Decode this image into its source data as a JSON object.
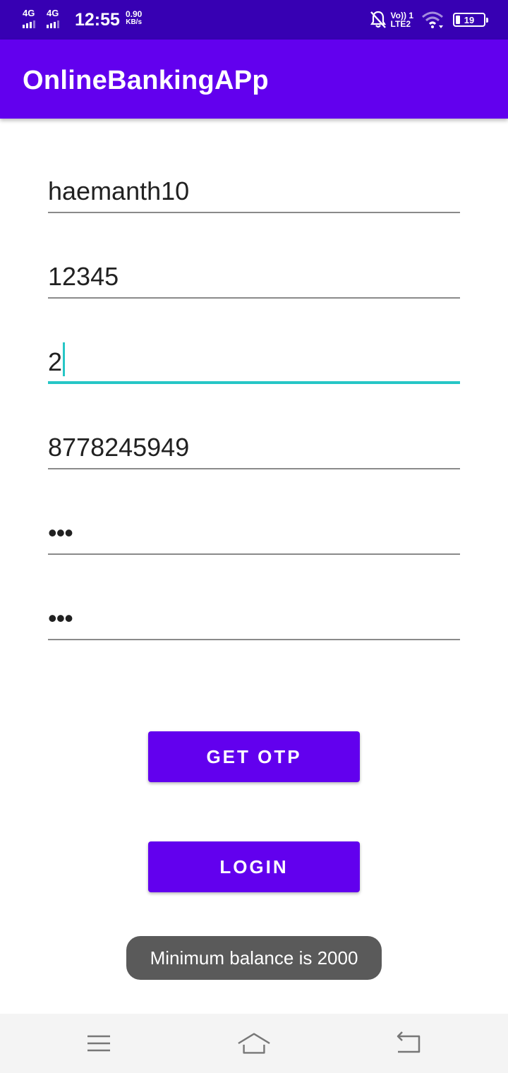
{
  "status_bar": {
    "sim1": "4G",
    "sim2": "4G",
    "time": "12:55",
    "speed_value": "0.90",
    "speed_unit": "KB/s",
    "volte_top": "Vo)) 1",
    "volte_bottom": "LTE2",
    "battery": "19"
  },
  "app_bar": {
    "title": "OnlineBankingAPp"
  },
  "form": {
    "fields": [
      {
        "value": "haemanth10"
      },
      {
        "value": "12345"
      },
      {
        "value": "2"
      },
      {
        "value": "8778245949"
      },
      {
        "value": "•••"
      },
      {
        "value": "•••"
      }
    ]
  },
  "buttons": {
    "get_otp": "GET OTP",
    "login": "LOGIN"
  },
  "toast": {
    "message": "Minimum balance is 2000"
  },
  "nav": {
    "icons": [
      "menu-icon",
      "home-icon",
      "back-icon"
    ]
  },
  "colors": {
    "status_bar": "#3700b3",
    "primary": "#6200ee",
    "accent": "#26c6c6",
    "toast": "#5a5a5a"
  }
}
